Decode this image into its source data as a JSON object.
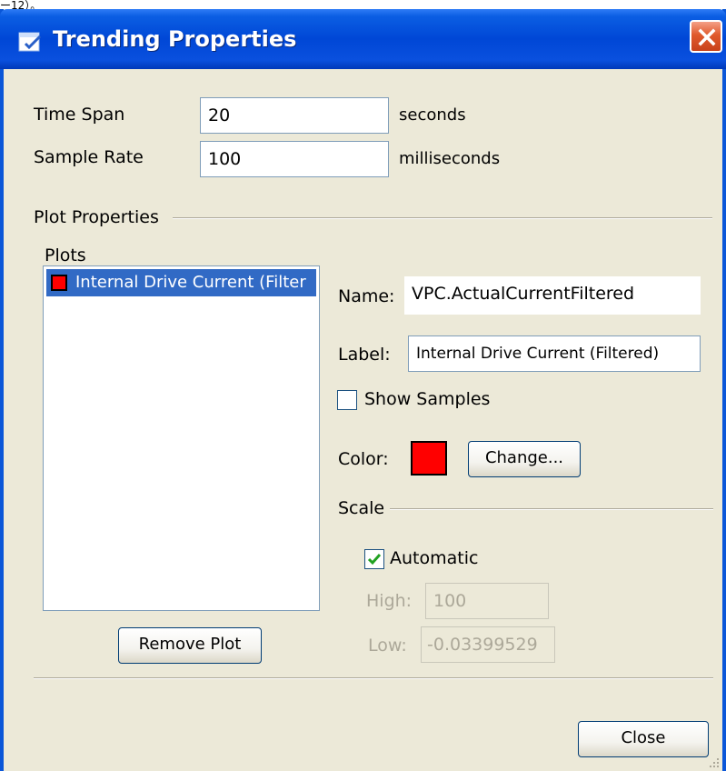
{
  "page_fragment": "ー12）。",
  "window": {
    "title": "Trending Properties",
    "icon": "properties-window-icon",
    "close_icon": "close-icon",
    "accent_color": "#0a56d8",
    "close_color": "#e05a2c"
  },
  "time_span": {
    "label": "Time Span",
    "value": "20",
    "unit": "seconds"
  },
  "sample_rate": {
    "label": "Sample Rate",
    "value": "100",
    "unit": "milliseconds"
  },
  "plot_properties": {
    "title": "Plot Properties",
    "plots_label": "Plots",
    "plots": [
      {
        "label": "Internal Drive Current (Filter",
        "color": "#ff0000",
        "selected": true
      }
    ],
    "remove_button": "Remove Plot",
    "name_label": "Name:",
    "name_value": "VPC.ActualCurrentFiltered",
    "label_label": "Label:",
    "label_value": "Internal Drive Current (Filtered)",
    "show_samples_label": "Show Samples",
    "show_samples_checked": false,
    "color_label": "Color:",
    "color_value": "#ff0000",
    "change_button": "Change...",
    "scale": {
      "title": "Scale",
      "automatic_label": "Automatic",
      "automatic_checked": true,
      "high_label": "High:",
      "high_value": "100",
      "low_label": "Low:",
      "low_value": "-0.03399529"
    }
  },
  "close_button": "Close"
}
